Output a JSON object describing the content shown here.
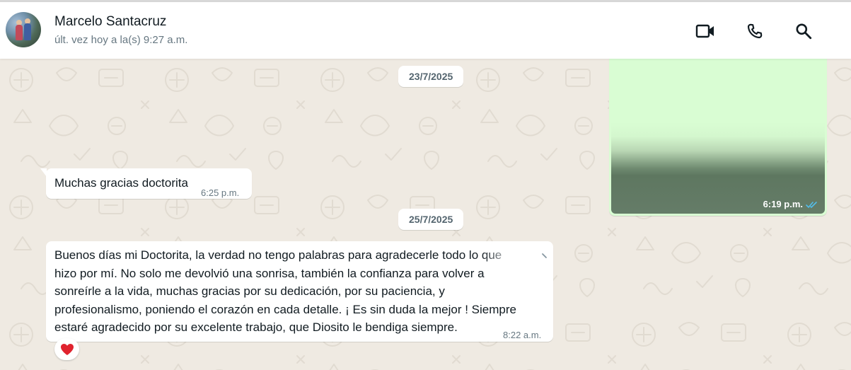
{
  "contact": {
    "name": "Marcelo Santacruz",
    "status": "últ. vez hoy a la(s) 9:27 a.m."
  },
  "header_icons": [
    "video-call-icon",
    "voice-call-icon",
    "search-icon"
  ],
  "messages": [
    {
      "date": "23/7/2025"
    },
    {
      "direction": "outgoing",
      "type": "image",
      "time": "6:19 p.m.",
      "status": "read"
    },
    {
      "direction": "incoming",
      "type": "text",
      "text": "Muchas gracias doctorita",
      "time": "6:25 p.m."
    },
    {
      "date": "25/7/2025"
    },
    {
      "direction": "incoming",
      "type": "text",
      "lines": [
        "Buenos días mi Doctorita, la verdad no tengo palabras para agradecerle todo lo que",
        "hizo por mí. No solo me devolvió una sonrisa, también la confianza para volver a",
        "sonreírle a la vida, muchas gracias por su dedicación, por su paciencia, y",
        "profesionalismo, poniendo el corazón en cada detalle. ¡ Es sin duda la mejor ! Siempre",
        "estaré agradecido por su excelente trabajo, que Diosito le bendiga siempre."
      ],
      "time": "8:22 a.m.",
      "reaction": "❤️"
    }
  ],
  "colors": {
    "wallpaper": "#efeae2",
    "outgoing_bubble": "#d9fdd3",
    "read_ticks": "#53bdeb",
    "reaction_heart": "#e0232e"
  }
}
